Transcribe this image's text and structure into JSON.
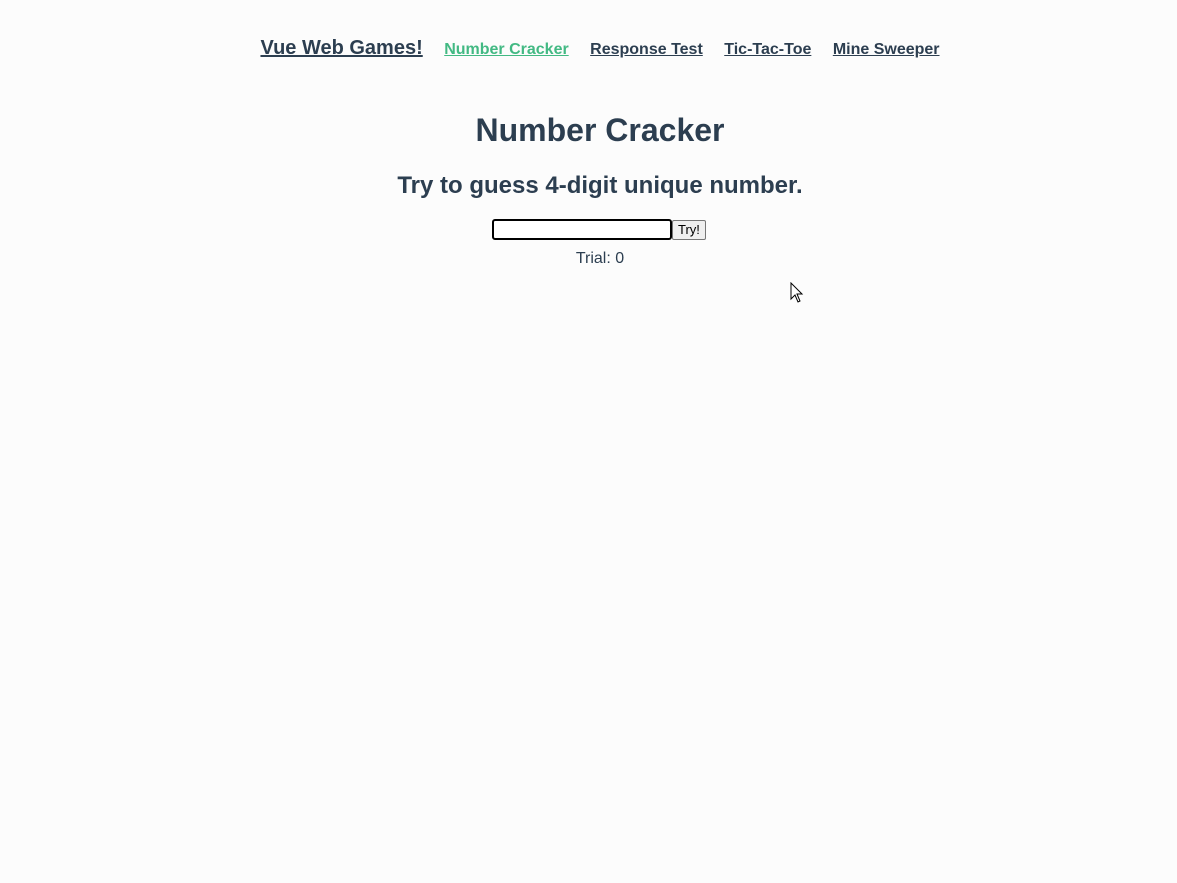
{
  "nav": {
    "brand": "Vue Web Games!",
    "links": [
      {
        "label": "Number Cracker",
        "active": true
      },
      {
        "label": "Response Test",
        "active": false
      },
      {
        "label": "Tic-Tac-Toe",
        "active": false
      },
      {
        "label": "Mine Sweeper",
        "active": false
      }
    ]
  },
  "main": {
    "title": "Number Cracker",
    "subtitle": "Try to guess 4-digit unique number.",
    "guess_input": {
      "value": "",
      "placeholder": ""
    },
    "try_label": "Try!",
    "trial_label": "Trial:",
    "trial_count": "0"
  },
  "colors": {
    "text": "#2c3e50",
    "active_link": "#42b983",
    "background": "#fcfcfc"
  },
  "icons": {
    "cursor": "mouse-pointer-icon"
  }
}
